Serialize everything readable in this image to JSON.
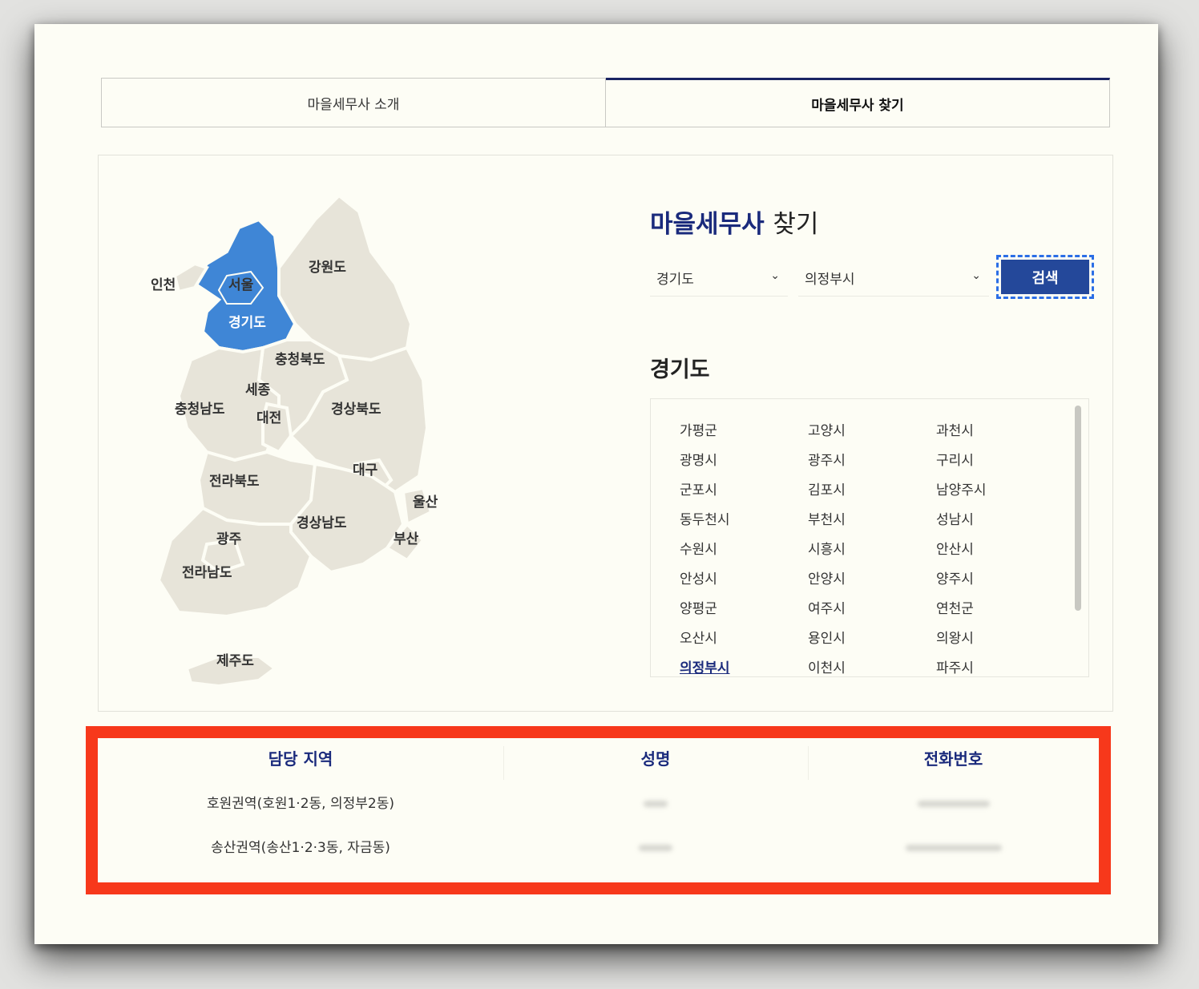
{
  "tabs": [
    {
      "label": "마을세무사 소개",
      "active": false
    },
    {
      "label": "마을세무사 찾기",
      "active": true
    }
  ],
  "search": {
    "title_main": "마을세무사",
    "title_sub": "찾기",
    "province_value": "경기도",
    "city_value": "의정부시",
    "button_label": "검색"
  },
  "map": {
    "selected": "경기도",
    "labels": {
      "incheon": "인천",
      "seoul": "서울",
      "gangwon": "강원도",
      "gyeonggi": "경기도",
      "chungbuk": "충청북도",
      "sejong": "세종",
      "chungnam": "충청남도",
      "daejeon": "대전",
      "gyeongbuk": "경상북도",
      "daegu": "대구",
      "jeonbuk": "전라북도",
      "ulsan": "울산",
      "gyeongnam": "경상남도",
      "gwangju": "광주",
      "busan": "부산",
      "jeonnam": "전라남도",
      "jeju": "제주도"
    }
  },
  "region_title": "경기도",
  "cities": [
    "가평군",
    "고양시",
    "과천시",
    "광명시",
    "광주시",
    "구리시",
    "군포시",
    "김포시",
    "남양주시",
    "동두천시",
    "부천시",
    "성남시",
    "수원시",
    "시흥시",
    "안산시",
    "안성시",
    "안양시",
    "양주시",
    "양평군",
    "여주시",
    "연천군",
    "오산시",
    "용인시",
    "의왕시",
    "의정부시",
    "이천시",
    "파주시"
  ],
  "active_city": "의정부시",
  "result": {
    "headers": {
      "area": "담당 지역",
      "name": "성명",
      "phone": "전화번호"
    },
    "rows": [
      {
        "area": "호원권역(호원1·2동, 의정부2동)"
      },
      {
        "area": "송산권역(송산1·2·3동, 자금동)"
      }
    ]
  },
  "colors": {
    "accent": "#1a2a7c",
    "map_selected": "#3f86d6",
    "highlight_border": "#f7381b",
    "button": "#24489a"
  }
}
